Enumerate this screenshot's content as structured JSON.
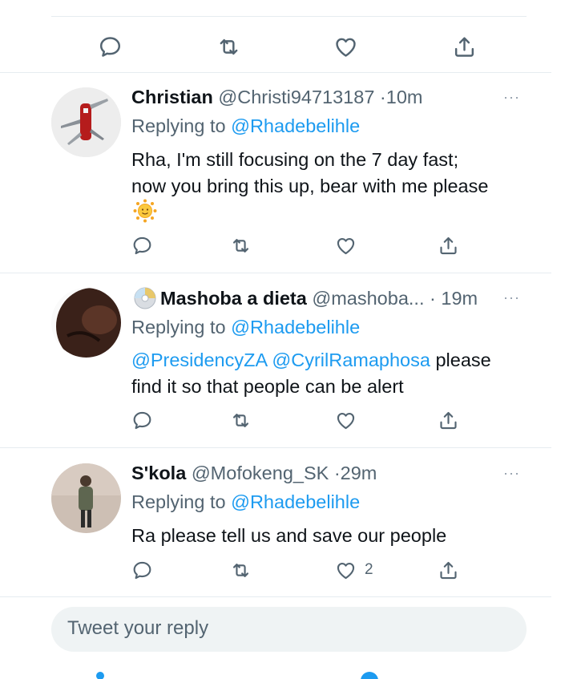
{
  "top_actions": {
    "icons": [
      "comment-icon",
      "retweet-icon",
      "like-icon",
      "share-icon"
    ]
  },
  "replies": [
    {
      "name": "Christian",
      "handle": "@Christi94713187",
      "separator": "·",
      "time": "10m",
      "more": "···",
      "replying_prefix": "Replying to",
      "replying_to": "@Rhadebelihle",
      "text_lines": [
        "Rha, I'm still focusing on the 7 day fast;",
        "now you bring this up, bear with me please"
      ],
      "emoji": "sun-emoji",
      "like_count": ""
    },
    {
      "name": "Mashoba a dieta",
      "handle": "@mashoba...",
      "separator": "·",
      "time": "19m",
      "more": "···",
      "replying_prefix": "Replying to",
      "replying_to": "@Rhadebelihle",
      "mention_1": "@PresidencyZA",
      "mention_2": "@CyrilRamaphosa",
      "text_line_1_rest": " please",
      "text_line_2": "find it so that people can be alert",
      "name_badge": "cd-disc-emoji",
      "like_count": ""
    },
    {
      "name": "S'kola",
      "handle": "@Mofokeng_SK",
      "separator": "·",
      "time": "29m",
      "more": "···",
      "replying_prefix": "Replying to",
      "replying_to": "@Rhadebelihle",
      "text_lines": [
        "Ra please tell us and save our people"
      ],
      "like_count": "2"
    }
  ],
  "reply_box": {
    "placeholder": "Tweet your reply"
  },
  "colors": {
    "link": "#1d9bf0",
    "muted": "#536471",
    "divider": "#e6ecf0",
    "reply_box_bg": "#eff3f4"
  }
}
